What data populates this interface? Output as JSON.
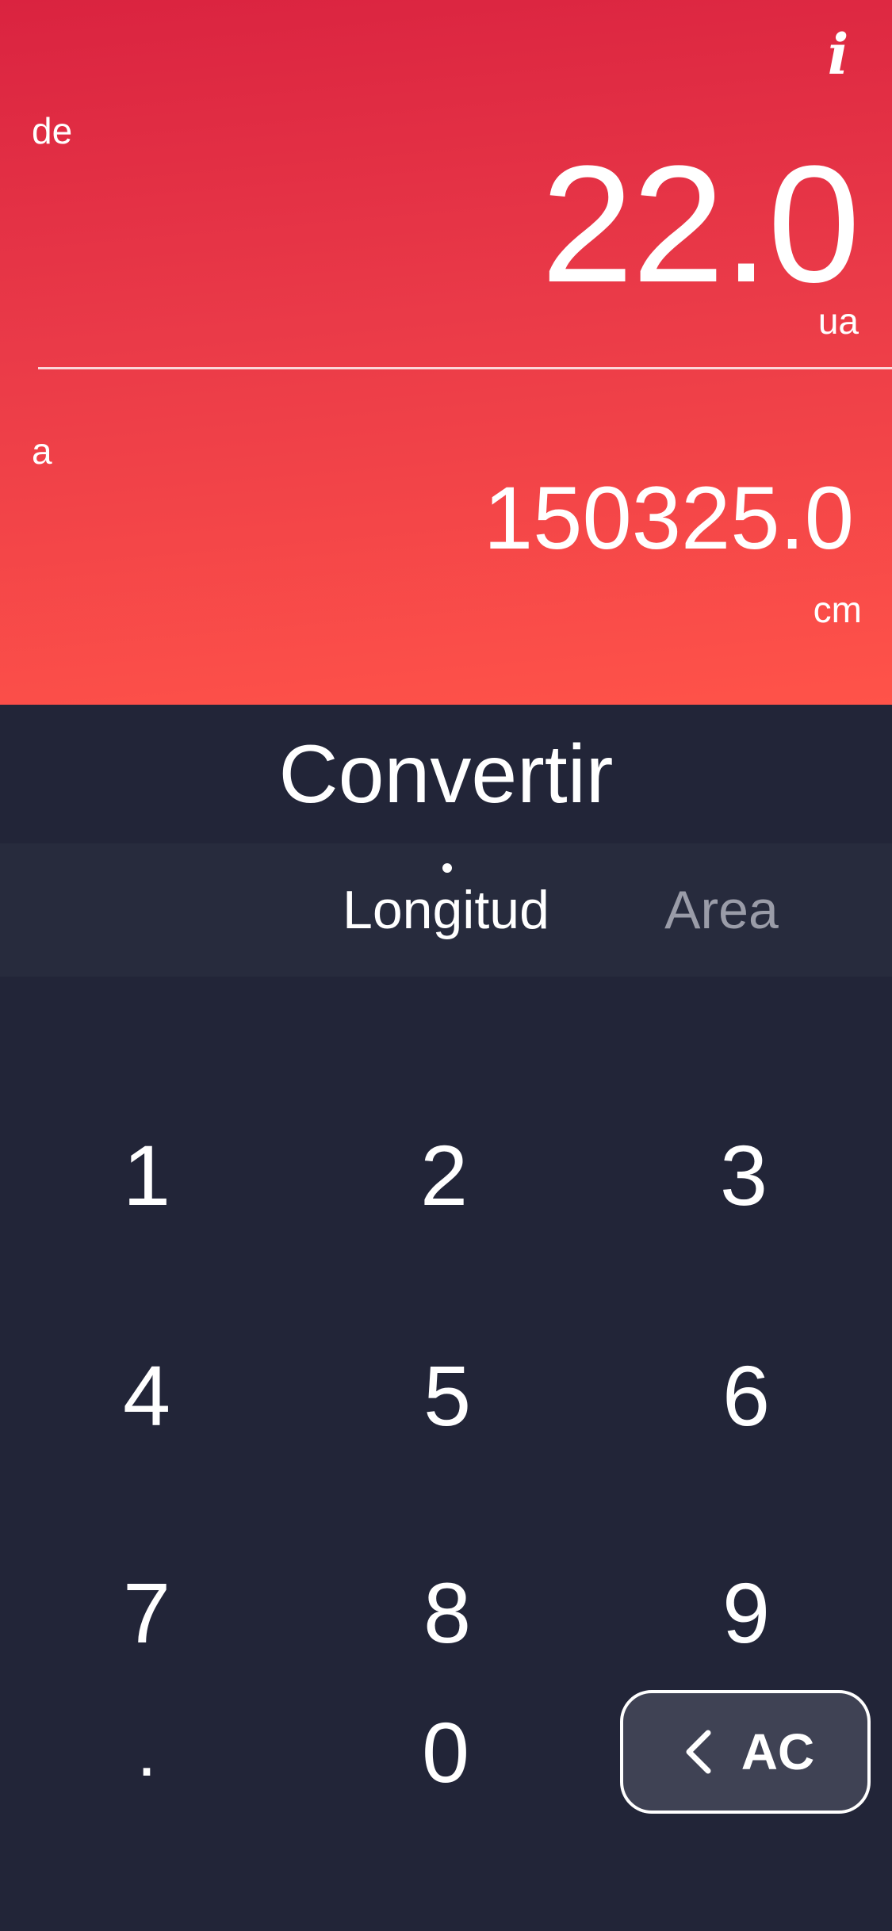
{
  "header": {
    "info_icon": "info-icon"
  },
  "from": {
    "label": "de",
    "value": "22.0",
    "unit": "ua"
  },
  "to": {
    "label": "a",
    "value": "150325.0",
    "unit": "cm"
  },
  "convert": {
    "title": "Convertir"
  },
  "tabs": [
    {
      "label": "Longitud",
      "selected": true
    },
    {
      "label": "Area",
      "selected": false
    }
  ],
  "keypad": {
    "keys": [
      "1",
      "2",
      "3",
      "4",
      "5",
      "6",
      "7",
      "8",
      "9",
      ".",
      "0"
    ],
    "backspace_label": "AC",
    "backspace_icon": "chevron-left-icon"
  },
  "colors": {
    "gradient_top": "#da2340",
    "gradient_bottom": "#ff5349",
    "panel_bg": "#222538",
    "tabs_bg": "#272b3d",
    "tab_inactive": "#9a9ca8",
    "backspace_bg": "#3f4254"
  }
}
